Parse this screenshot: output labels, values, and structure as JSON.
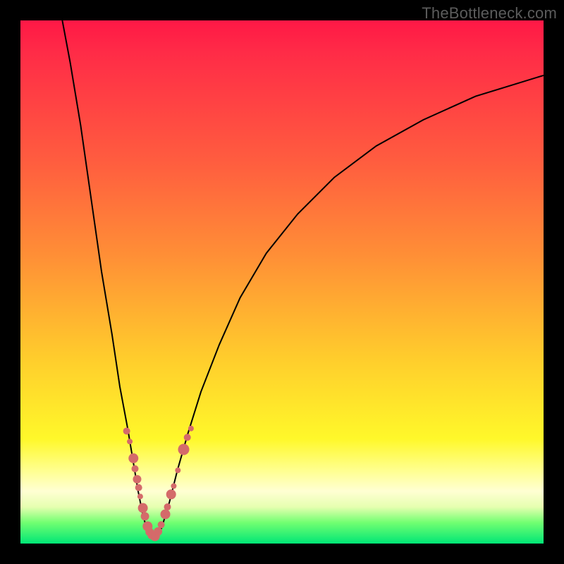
{
  "watermark": "TheBottleneck.com",
  "colors": {
    "frame": "#000000",
    "marker": "#d46a6a",
    "curve": "#000000"
  },
  "chart_data": {
    "type": "line",
    "title": "",
    "xlabel": "",
    "ylabel": "",
    "xlim": [
      0,
      100
    ],
    "ylim": [
      0,
      100
    ],
    "grid": false,
    "legend": false,
    "curve_points": [
      {
        "x": 8.0,
        "y": 100.0
      },
      {
        "x": 9.5,
        "y": 92.0
      },
      {
        "x": 11.5,
        "y": 80.0
      },
      {
        "x": 13.5,
        "y": 66.0
      },
      {
        "x": 15.5,
        "y": 52.0
      },
      {
        "x": 17.5,
        "y": 40.0
      },
      {
        "x": 19.0,
        "y": 30.0
      },
      {
        "x": 20.5,
        "y": 22.0
      },
      {
        "x": 21.5,
        "y": 16.0
      },
      {
        "x": 22.5,
        "y": 10.0
      },
      {
        "x": 23.3,
        "y": 6.0
      },
      {
        "x": 24.2,
        "y": 2.5
      },
      {
        "x": 25.0,
        "y": 1.0
      },
      {
        "x": 25.8,
        "y": 1.0
      },
      {
        "x": 27.0,
        "y": 3.0
      },
      {
        "x": 28.5,
        "y": 8.0
      },
      {
        "x": 30.0,
        "y": 14.0
      },
      {
        "x": 32.0,
        "y": 21.0
      },
      {
        "x": 34.5,
        "y": 29.0
      },
      {
        "x": 38.0,
        "y": 38.0
      },
      {
        "x": 42.0,
        "y": 47.0
      },
      {
        "x": 47.0,
        "y": 55.5
      },
      {
        "x": 53.0,
        "y": 63.0
      },
      {
        "x": 60.0,
        "y": 70.0
      },
      {
        "x": 68.0,
        "y": 76.0
      },
      {
        "x": 77.0,
        "y": 81.0
      },
      {
        "x": 87.0,
        "y": 85.5
      },
      {
        "x": 100.0,
        "y": 89.5
      }
    ],
    "markers_left": [
      {
        "x": 20.3,
        "y": 21.5,
        "r": 5
      },
      {
        "x": 20.9,
        "y": 19.5,
        "r": 4
      },
      {
        "x": 21.6,
        "y": 16.3,
        "r": 7
      },
      {
        "x": 21.9,
        "y": 14.3,
        "r": 5
      },
      {
        "x": 22.3,
        "y": 12.3,
        "r": 6
      },
      {
        "x": 22.6,
        "y": 10.7,
        "r": 5
      },
      {
        "x": 22.9,
        "y": 9.0,
        "r": 4
      },
      {
        "x": 23.4,
        "y": 6.8,
        "r": 7
      },
      {
        "x": 23.8,
        "y": 5.2,
        "r": 6
      },
      {
        "x": 24.3,
        "y": 3.3,
        "r": 7
      },
      {
        "x": 24.7,
        "y": 2.2,
        "r": 6
      },
      {
        "x": 25.0,
        "y": 1.5,
        "r": 5
      }
    ],
    "markers_right": [
      {
        "x": 25.7,
        "y": 1.4,
        "r": 7
      },
      {
        "x": 26.3,
        "y": 2.3,
        "r": 6
      },
      {
        "x": 26.9,
        "y": 3.6,
        "r": 5
      },
      {
        "x": 27.7,
        "y": 5.6,
        "r": 7
      },
      {
        "x": 28.1,
        "y": 7.0,
        "r": 5
      },
      {
        "x": 28.8,
        "y": 9.4,
        "r": 7
      },
      {
        "x": 29.3,
        "y": 11.0,
        "r": 4
      },
      {
        "x": 30.1,
        "y": 14.0,
        "r": 4
      },
      {
        "x": 31.2,
        "y": 18.0,
        "r": 8
      },
      {
        "x": 31.9,
        "y": 20.3,
        "r": 5
      },
      {
        "x": 32.6,
        "y": 22.0,
        "r": 4
      }
    ]
  }
}
